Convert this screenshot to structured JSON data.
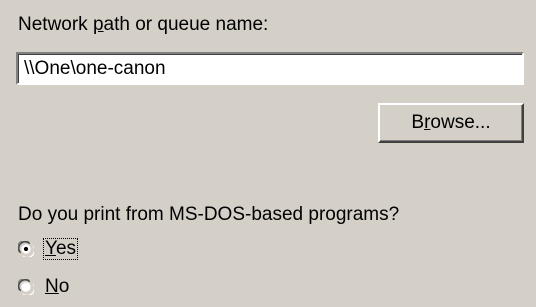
{
  "network_path": {
    "label_before": "Network ",
    "label_mnemonic": "p",
    "label_after": "ath or queue name:",
    "value": "\\\\One\\one-canon"
  },
  "browse_button": {
    "label_before": "B",
    "label_mnemonic": "r",
    "label_after": "owse..."
  },
  "msdos": {
    "question": "Do you print from MS-DOS-based programs?",
    "options": [
      {
        "mnemonic": "Y",
        "rest": "es",
        "selected": true,
        "focused": true
      },
      {
        "mnemonic": "N",
        "rest": "o",
        "selected": false,
        "focused": false
      }
    ]
  },
  "colors": {
    "dialog_bg": "#d4d0c8",
    "field_bg": "#ffffff",
    "text": "#000000"
  }
}
